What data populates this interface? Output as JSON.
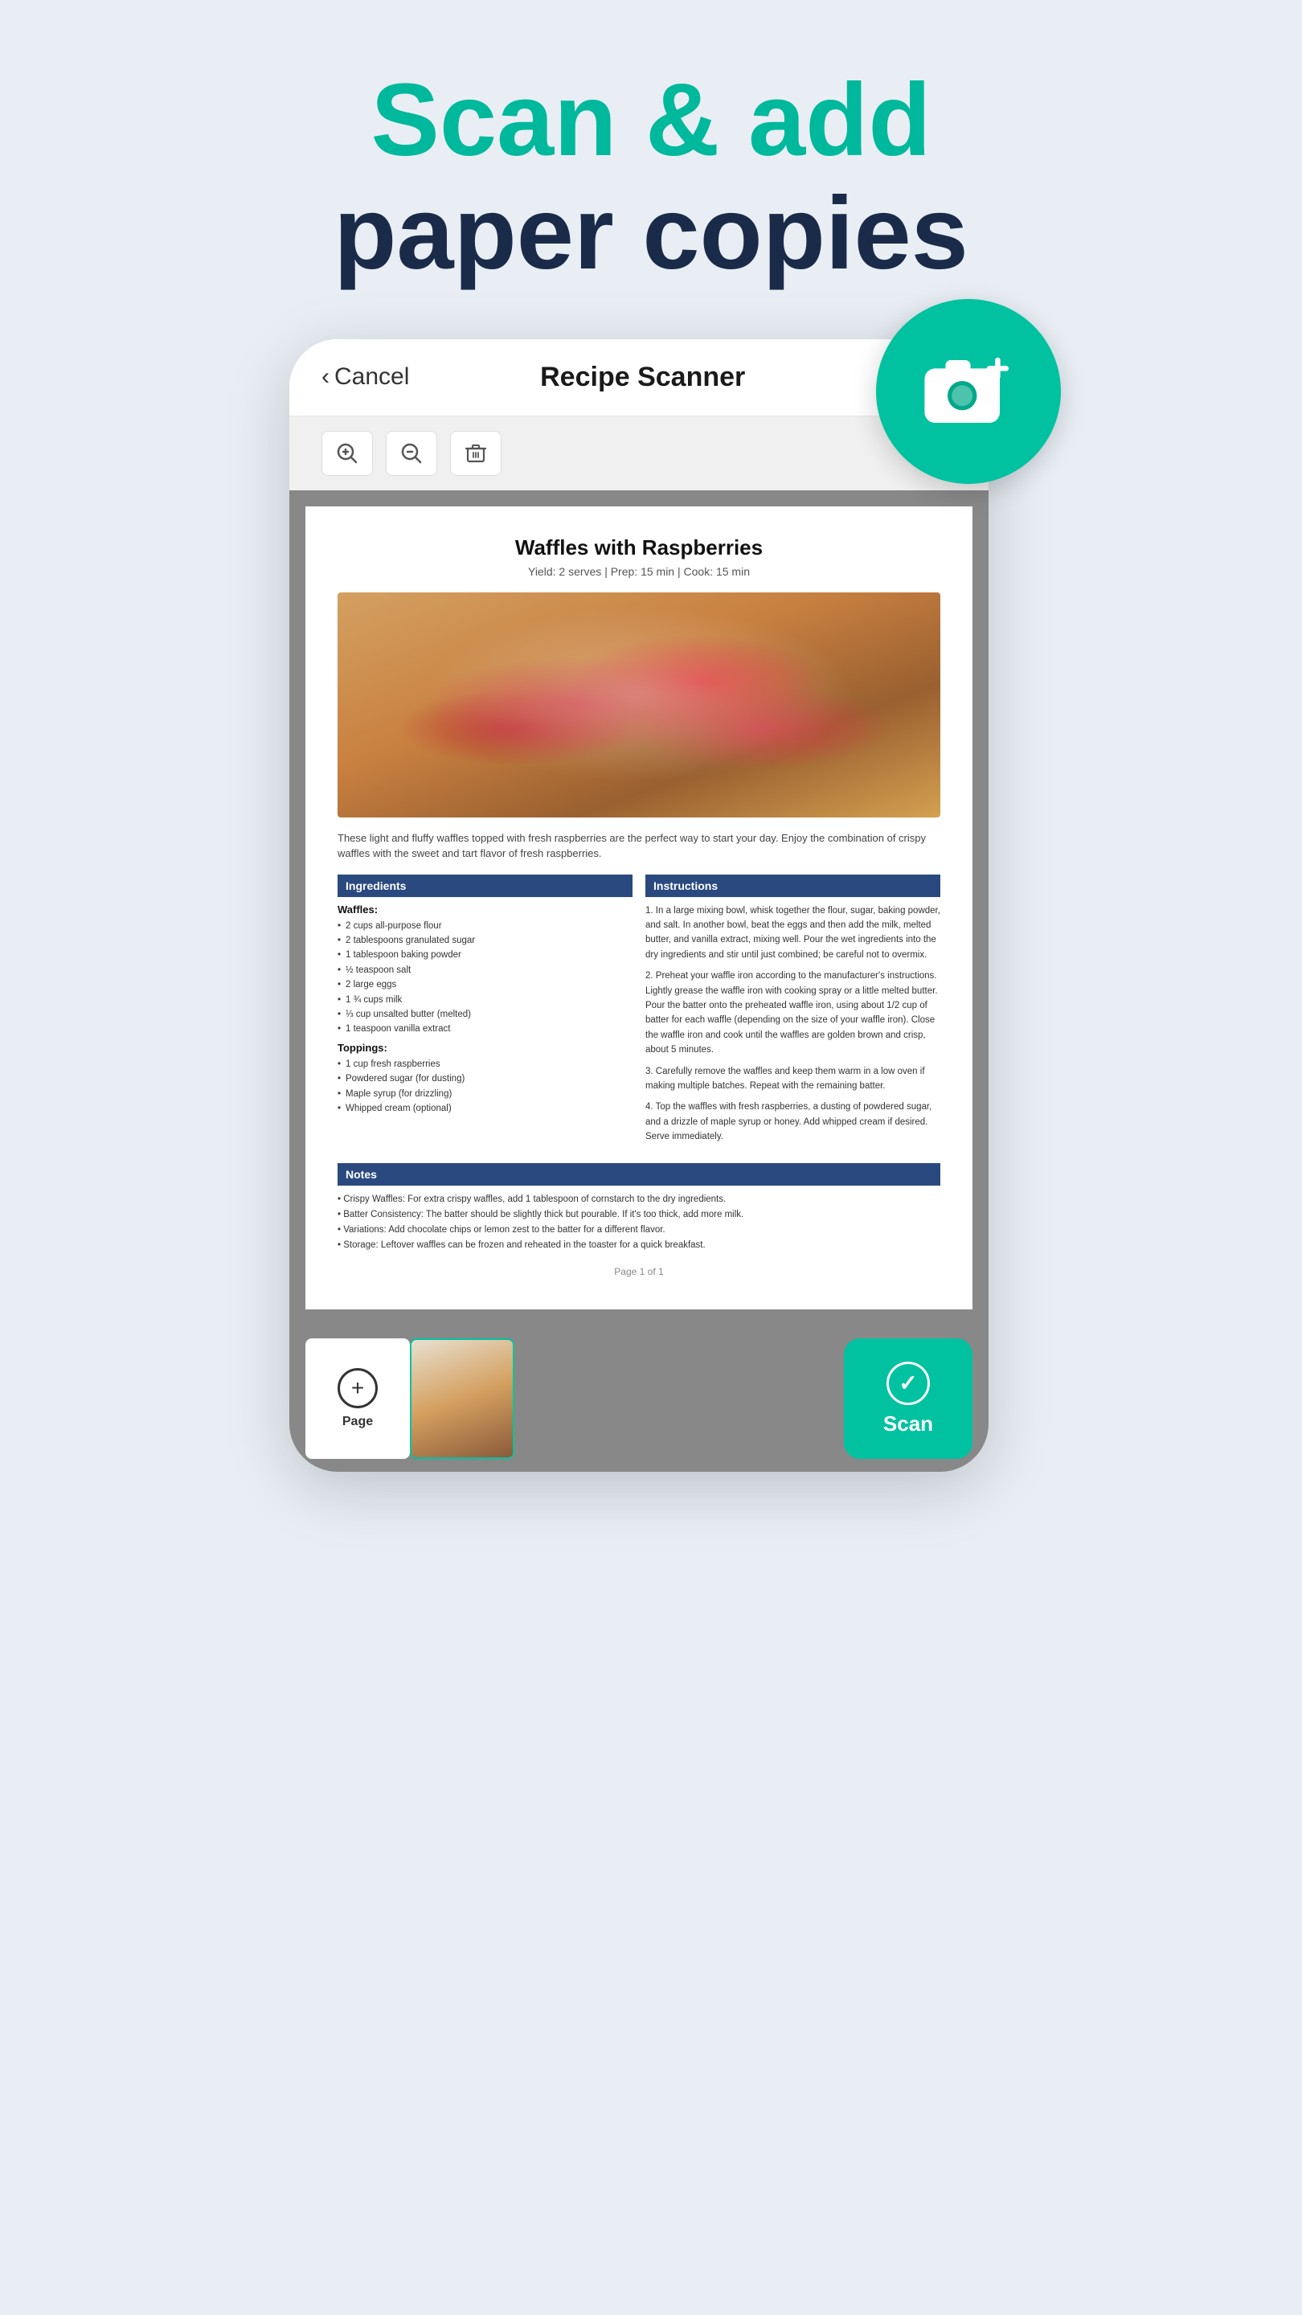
{
  "hero": {
    "line1": "Scan & add",
    "line2": "paper copies"
  },
  "nav": {
    "cancel_label": "Cancel",
    "title": "Recipe Scanner"
  },
  "toolbar": {
    "zoom_in": "⊕",
    "zoom_out": "⊖",
    "delete": "🗑"
  },
  "document": {
    "title": "Waffles with Raspberries",
    "meta": "Yield: 2 serves  |  Prep: 15 min  |  Cook: 15 min",
    "description": "These light and fluffy waffles topped with fresh raspberries are the perfect way to start your day. Enjoy the combination of crispy waffles with the sweet and tart flavor of fresh raspberries.",
    "ingredients_header": "Ingredients",
    "instructions_header": "Instructions",
    "notes_header": "Notes",
    "waffles_section": "Waffles:",
    "ingredients_waffles": [
      "2 cups all-purpose flour",
      "2 tablespoons granulated sugar",
      "1 tablespoon baking powder",
      "½ teaspoon salt",
      "2 large eggs",
      "1 ¾ cups milk",
      "⅓ cup unsalted butter (melted)",
      "1 teaspoon vanilla extract"
    ],
    "toppings_section": "Toppings:",
    "ingredients_toppings": [
      "1 cup fresh raspberries",
      "Powdered sugar (for dusting)",
      "Maple syrup (for drizzling)",
      "Whipped cream (optional)"
    ],
    "instructions": [
      "1. In a large mixing bowl, whisk together the flour, sugar, baking powder, and salt. In another bowl, beat the eggs and then add the milk, melted butter, and vanilla extract, mixing well. Pour the wet ingredients into the dry ingredients and stir until just combined; be careful not to overmix.",
      "2. Preheat your waffle iron according to the manufacturer's instructions. Lightly grease the waffle iron with cooking spray or a little melted butter. Pour the batter onto the preheated waffle iron, using about 1/2 cup of batter for each waffle (depending on the size of your waffle iron). Close the waffle iron and cook until the waffles are golden brown and crisp, about 5 minutes.",
      "3. Carefully remove the waffles and keep them warm in a low oven if making multiple batches. Repeat with the remaining batter.",
      "4. Top the waffles with fresh raspberries, a dusting of powdered sugar, and a drizzle of maple syrup or honey. Add whipped cream if desired. Serve immediately."
    ],
    "notes": [
      "• Crispy Waffles: For extra crispy waffles, add 1 tablespoon of cornstarch to the dry ingredients.",
      "• Batter Consistency: The batter should be slightly thick but pourable. If it's too thick, add more milk.",
      "• Variations: Add chocolate chips or lemon zest to the batter for a different flavor.",
      "• Storage: Leftover waffles can be frozen and reheated in the toaster for a quick breakfast."
    ],
    "page_indicator": "Page 1 of 1"
  },
  "bottom_bar": {
    "add_label": "Page",
    "scan_label": "Scan"
  },
  "camera_icon": "📷"
}
